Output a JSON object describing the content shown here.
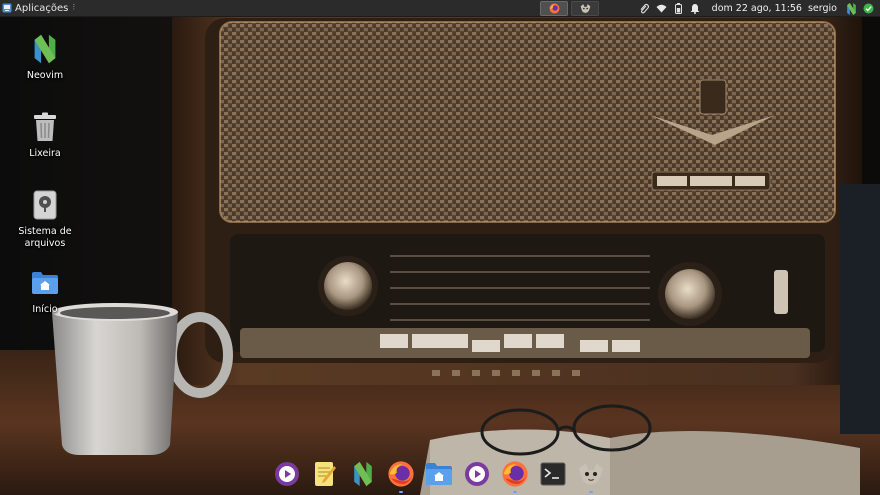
{
  "panel": {
    "apps_menu_label": "Aplicações",
    "clock": "dom 22 ago, 11:56",
    "username": "sergio"
  },
  "taskbar": {
    "windows": [
      {
        "icon": "firefox-icon",
        "active": true
      },
      {
        "icon": "gimp-icon",
        "active": false
      }
    ]
  },
  "tray": {
    "icons": [
      "paperclip-icon",
      "wifi-icon",
      "battery-icon",
      "bell-icon"
    ]
  },
  "desktop": {
    "icons": [
      {
        "label": "Neovim",
        "icon": "neovim-icon"
      },
      {
        "label": "Lixeira",
        "icon": "trash-icon"
      },
      {
        "label": "Sistema de arquivos",
        "icon": "filesystem-icon"
      },
      {
        "label": "Início",
        "icon": "home-folder-icon"
      }
    ]
  },
  "dock": {
    "items": [
      {
        "icon": "media-player-icon",
        "running": false
      },
      {
        "icon": "text-editor-icon",
        "running": false
      },
      {
        "icon": "neovim-icon",
        "running": false
      },
      {
        "icon": "firefox-icon",
        "running": true
      },
      {
        "icon": "file-manager-icon",
        "running": false
      },
      {
        "icon": "media-player-icon",
        "running": false
      },
      {
        "icon": "firefox-icon",
        "running": true
      },
      {
        "icon": "terminal-icon",
        "running": false
      },
      {
        "icon": "gimp-icon",
        "running": true
      }
    ]
  },
  "colors": {
    "panel_bg": "#2b2b2b",
    "accent": "#6aa7ff",
    "neovim_green": "#4fae47",
    "neovim_blue": "#3e90c9",
    "firefox_orange": "#ff7139",
    "media_purple": "#7a3aa0"
  }
}
